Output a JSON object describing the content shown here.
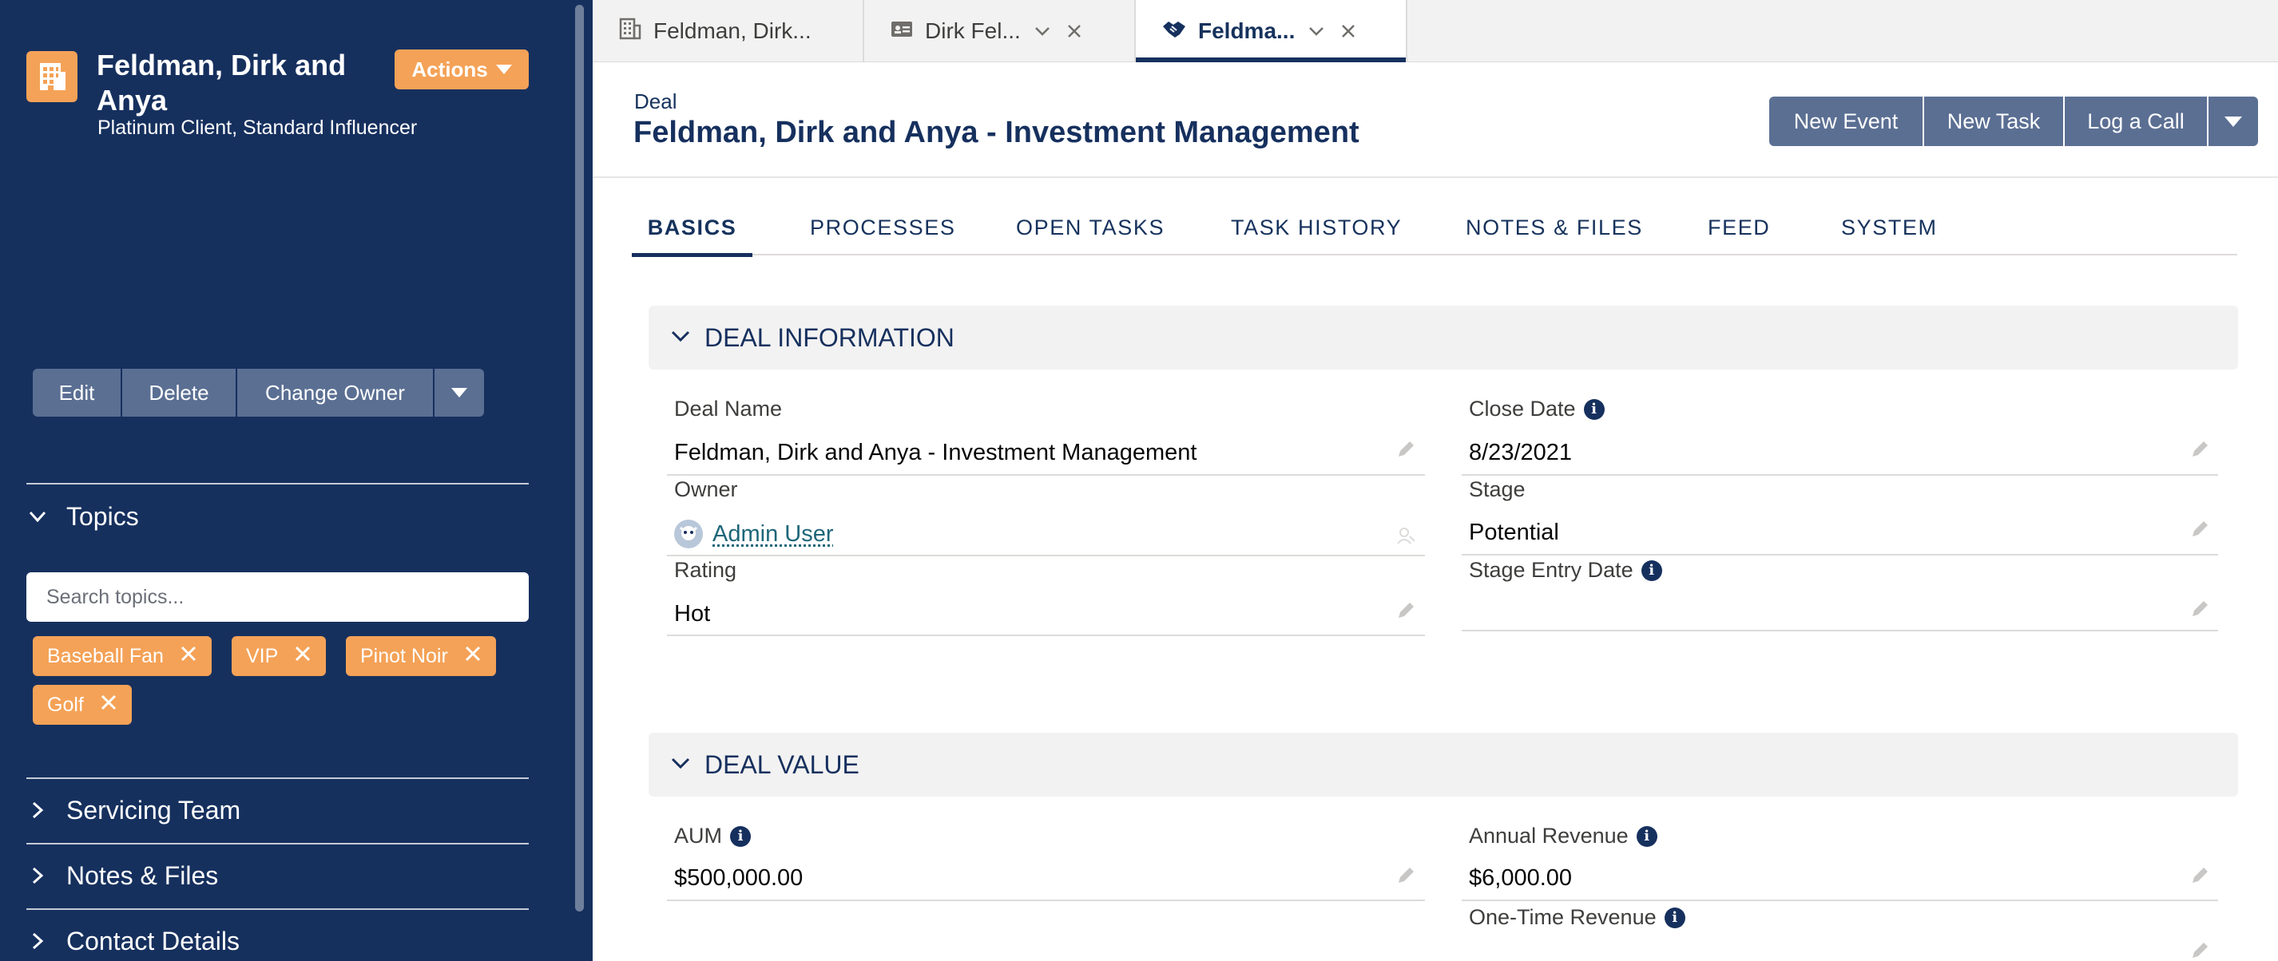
{
  "sidebar": {
    "account_icon": "building-icon",
    "account_name": "Feldman, Dirk and Anya",
    "account_subtitle": "Platinum Client, Standard Influencer",
    "actions_label": "Actions",
    "buttons": {
      "edit": "Edit",
      "delete": "Delete",
      "change_owner": "Change Owner"
    },
    "topics": {
      "title": "Topics",
      "search_placeholder": "Search topics...",
      "tags": [
        "Baseball Fan",
        "VIP",
        "Pinot Noir",
        "Golf"
      ]
    },
    "sections": [
      "Servicing Team",
      "Notes & Files",
      "Contact Details"
    ]
  },
  "tabs": [
    {
      "label": "Feldman, Dirk...",
      "icon": "building-icon"
    },
    {
      "label": "Dirk Fel...",
      "icon": "contact-card-icon"
    },
    {
      "label": "Feldma...",
      "icon": "handshake-icon"
    }
  ],
  "record": {
    "type": "Deal",
    "title": "Feldman, Dirk and Anya - Investment Management"
  },
  "header_actions": {
    "new_event": "New Event",
    "new_task": "New Task",
    "log_call": "Log a Call"
  },
  "subtabs": [
    "BASICS",
    "PROCESSES",
    "OPEN TASKS",
    "TASK HISTORY",
    "NOTES & FILES",
    "FEED",
    "SYSTEM"
  ],
  "deal_information": {
    "title": "DEAL INFORMATION",
    "deal_name_label": "Deal Name",
    "deal_name": "Feldman, Dirk and Anya - Investment Management",
    "close_date_label": "Close Date",
    "close_date": "8/23/2021",
    "owner_label": "Owner",
    "owner": "Admin User",
    "stage_label": "Stage",
    "stage": "Potential",
    "rating_label": "Rating",
    "rating": "Hot",
    "stage_entry_date_label": "Stage Entry Date",
    "stage_entry_date": ""
  },
  "deal_value": {
    "title": "DEAL VALUE",
    "aum_label": "AUM",
    "aum": "$500,000.00",
    "annual_revenue_label": "Annual Revenue",
    "annual_revenue": "$6,000.00",
    "one_time_revenue_label": "One-Time Revenue"
  },
  "colors": {
    "sidebar_bg": "#16305e",
    "accent_orange": "#f4a257",
    "button_slate": "#5b6f93",
    "link_teal": "#1d6679"
  }
}
